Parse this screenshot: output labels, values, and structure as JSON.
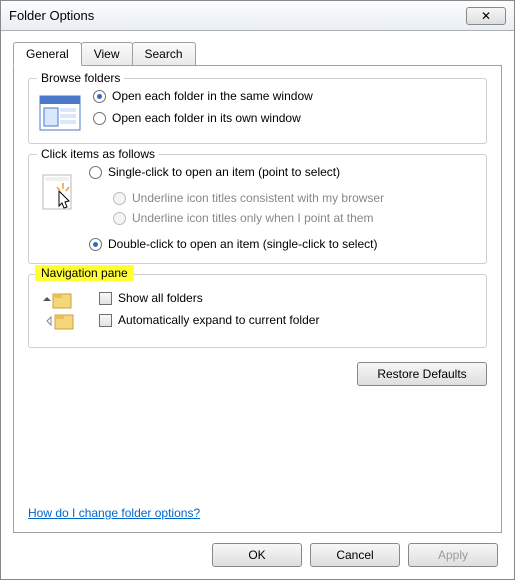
{
  "window": {
    "title": "Folder Options"
  },
  "tabs": {
    "general": "General",
    "view": "View",
    "search": "Search"
  },
  "browse": {
    "legend": "Browse folders",
    "same_window": "Open each folder in the same window",
    "own_window": "Open each folder in its own window"
  },
  "click": {
    "legend": "Click items as follows",
    "single": "Single-click to open an item (point to select)",
    "underline_browser": "Underline icon titles consistent with my browser",
    "underline_point": "Underline icon titles only when I point at them",
    "double": "Double-click to open an item (single-click to select)"
  },
  "nav": {
    "legend": "Navigation pane",
    "show_all": "Show all folders",
    "auto_expand": "Automatically expand to current folder"
  },
  "restore": "Restore Defaults",
  "help": "How do I change folder options?",
  "buttons": {
    "ok": "OK",
    "cancel": "Cancel",
    "apply": "Apply"
  }
}
